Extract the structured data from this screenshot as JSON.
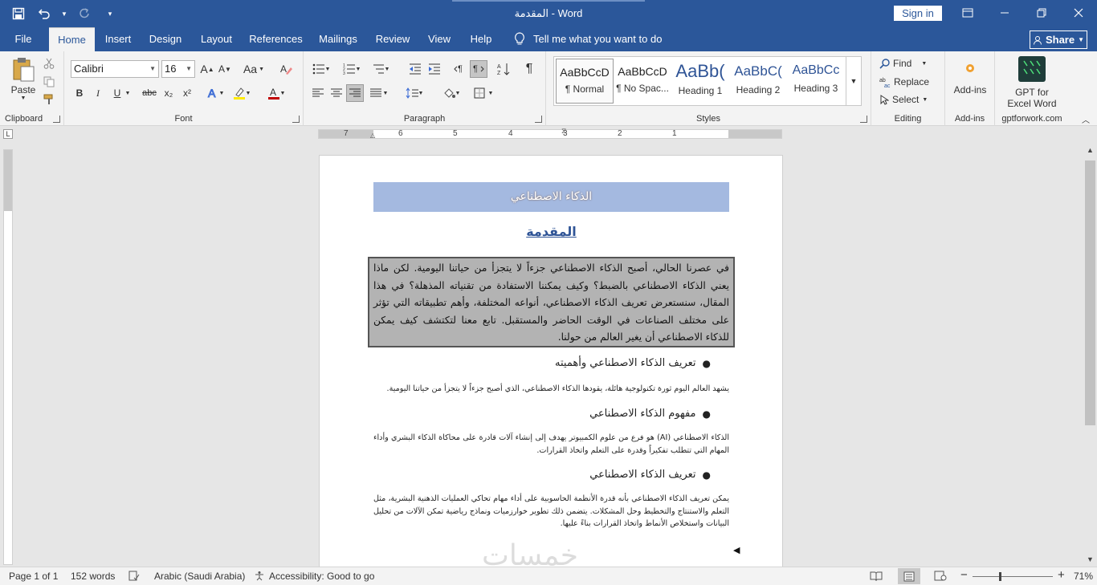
{
  "window": {
    "title": "المقدمة  -  Word",
    "signin_label": "Sign in"
  },
  "tabs": [
    {
      "label": "File"
    },
    {
      "label": "Home"
    },
    {
      "label": "Insert"
    },
    {
      "label": "Design"
    },
    {
      "label": "Layout"
    },
    {
      "label": "References"
    },
    {
      "label": "Mailings"
    },
    {
      "label": "Review"
    },
    {
      "label": "View"
    },
    {
      "label": "Help"
    }
  ],
  "active_tab": "Home",
  "tell_me": "Tell me what you want to do",
  "share_label": "Share",
  "ribbon": {
    "clipboard": {
      "paste_label": "Paste",
      "group_label": "Clipboard"
    },
    "font": {
      "font_name": "Calibri",
      "font_size": "16",
      "group_label": "Font",
      "bold": "B",
      "italic": "I",
      "underline": "U",
      "strike": "abc",
      "sub": "x₂",
      "sup": "x²",
      "case": "Aa",
      "grow": "A",
      "shrink": "A"
    },
    "paragraph": {
      "group_label": "Paragraph"
    },
    "styles": {
      "group_label": "Styles",
      "items": [
        {
          "sample": "AaBbCcD",
          "name": "¶ Normal"
        },
        {
          "sample": "AaBbCcD",
          "name": "¶ No Spac..."
        },
        {
          "sample": "AaBb(",
          "name": "Heading 1"
        },
        {
          "sample": "AaBbC(",
          "name": "Heading 2"
        },
        {
          "sample": "AaBbCc",
          "name": "Heading 3"
        }
      ]
    },
    "editing": {
      "find": "Find",
      "replace": "Replace",
      "select": "Select",
      "group_label": "Editing"
    },
    "addins": {
      "label": "Add-ins",
      "group_label": "Add-ins"
    },
    "gpt": {
      "label_line1": "GPT for",
      "label_line2": "Excel Word",
      "group_label": "gptforwork.com"
    }
  },
  "ruler": {
    "numbers": [
      "7",
      "6",
      "5",
      "4",
      "3",
      "2",
      "1"
    ]
  },
  "document": {
    "title": "الذكاء الاصطناعي",
    "heading": "المقدمة",
    "intro": "في عصرنا الحالي، أصبح الذكاء الاصطناعي جزءاً لا يتجزأ من حياتنا اليومية. لكن ماذا يعني الذكاء الاصطناعي بالضبط؟ وكيف يمكننا الاستفادة من تقنياته المذهلة؟ في هذا المقال، سنستعرض تعريف الذكاء الاصطناعي، أنواعه المختلفة، وأهم تطبيقاته التي تؤثر على مختلف الصناعات في الوقت الحاضر والمستقبل. تابع معنا لتكتشف كيف يمكن للذكاء الاصطناعي أن يغير العالم من حولنا.",
    "sections": [
      {
        "heading": "تعريف الذكاء الاصطناعي وأهميته",
        "body": "يشهد العالم اليوم ثورة تكنولوجية هائلة، يقودها الذكاء الاصطناعي، الذي أصبح جزءاً لا يتجزأ من حياتنا اليومية."
      },
      {
        "heading": "مفهوم الذكاء الاصطناعي",
        "body": "الذكاء الاصطناعي (AI) هو فرع من علوم الكمبيوتر يهدف إلى إنشاء آلات قادرة على محاكاة الذكاء البشري وأداء المهام التي تتطلب تفكيراً وقدرة على التعلم واتخاذ القرارات."
      },
      {
        "heading": "تعريف الذكاء الاصطناعي",
        "body": "يمكن تعريف الذكاء الاصطناعي بأنه قدرة الأنظمة الحاسوبية على أداء مهام تحاكي العمليات الذهنية البشرية، مثل التعلم والاستنتاج والتخطيط وحل المشكلات. يتضمن ذلك تطوير خوارزميات ونماذج رياضية تمكن الآلات من تحليل البيانات واستخلاص الأنماط واتخاذ القرارات بناءً عليها."
      }
    ],
    "watermark": "خمسات"
  },
  "status": {
    "page": "Page 1 of 1",
    "words": "152 words",
    "language": "Arabic (Saudi Arabia)",
    "accessibility": "Accessibility: Good to go",
    "zoom_out": "−",
    "zoom_in": "+",
    "zoom": "71%",
    "zoom_level": 0.71
  }
}
